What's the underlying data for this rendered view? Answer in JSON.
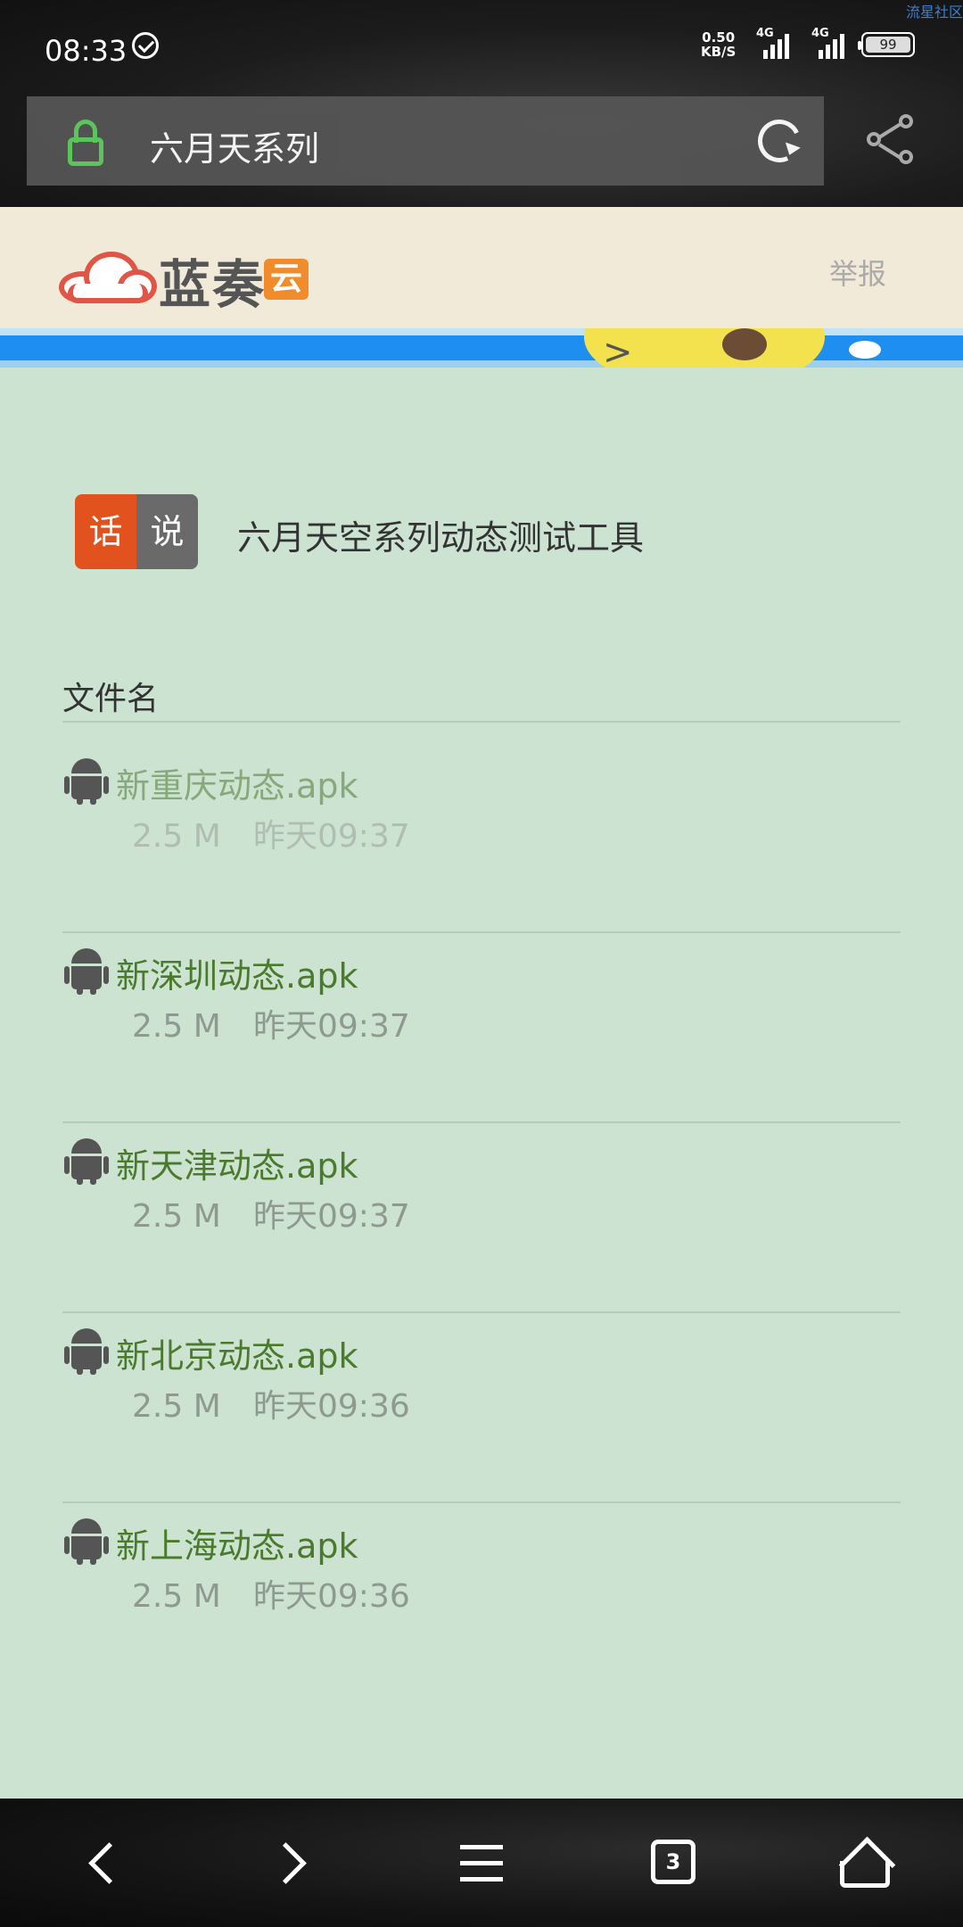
{
  "watermark": "流星社区",
  "status_bar": {
    "time": "08:33",
    "net_speed_value": "0.50",
    "net_speed_unit": "KB/S",
    "signal1_label": "4G",
    "signal2_label": "4G",
    "battery": "99"
  },
  "browser": {
    "page_title": "六月天系列"
  },
  "site": {
    "logo_text": "蓝奏",
    "logo_badge": "云",
    "report_label": "举报"
  },
  "description": {
    "badge_left": "话",
    "badge_right": "说",
    "text": "六月天空系列动态测试工具"
  },
  "table": {
    "header": "文件名",
    "files": [
      {
        "name": "新重庆动态.apk",
        "size": "2.5 M",
        "time": "昨天09:37"
      },
      {
        "name": "新深圳动态.apk",
        "size": "2.5 M",
        "time": "昨天09:37"
      },
      {
        "name": "新天津动态.apk",
        "size": "2.5 M",
        "time": "昨天09:37"
      },
      {
        "name": "新北京动态.apk",
        "size": "2.5 M",
        "time": "昨天09:36"
      },
      {
        "name": "新上海动态.apk",
        "size": "2.5 M",
        "time": "昨天09:36"
      }
    ]
  },
  "bottom_nav": {
    "tab_count": "3"
  },
  "colors": {
    "page_bg": "#cde3d1",
    "link_green": "#4a7a2c",
    "badge_orange": "#e1521e",
    "lock_green": "#5fcf5f"
  }
}
